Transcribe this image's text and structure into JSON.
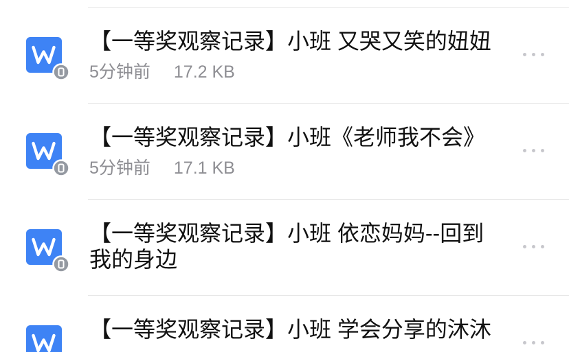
{
  "files": [
    {
      "icon": "word-document-icon",
      "badge_icon": "mobile-badge-icon",
      "title": "【一等奖观察记录】小班 又哭又笑的妞妞",
      "time": "5分钟前",
      "size": "17.2 KB",
      "more_icon": "more-dots-icon"
    },
    {
      "icon": "word-document-icon",
      "badge_icon": "mobile-badge-icon",
      "title": "【一等奖观察记录】小班《老师我不会》",
      "time": "5分钟前",
      "size": "17.1 KB",
      "more_icon": "more-dots-icon"
    },
    {
      "icon": "word-document-icon",
      "badge_icon": "mobile-badge-icon",
      "title": "【一等奖观察记录】小班 依恋妈妈--回到我的身边",
      "more_icon": "more-dots-icon"
    },
    {
      "icon": "word-document-icon",
      "title": "【一等奖观察记录】小班 学会分享的沐沐",
      "more_icon": "more-dots-icon"
    }
  ],
  "colors": {
    "icon_blue": "#3e83f5",
    "badge_gray": "#9499a1",
    "title_text": "#111111",
    "meta_text": "#8e8e93",
    "divider": "#e6e6e6",
    "dots": "#c7c7cc"
  }
}
